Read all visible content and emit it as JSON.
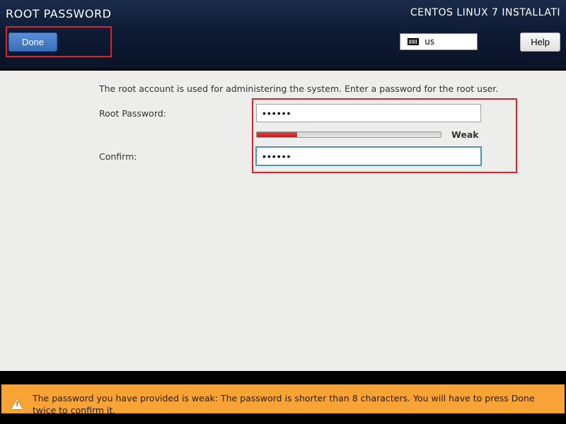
{
  "header": {
    "page_title": "ROOT PASSWORD",
    "installer_title": "CENTOS LINUX 7 INSTALLATI",
    "done_label": "Done",
    "keyboard_layout": "us",
    "help_label": "Help"
  },
  "main": {
    "description": "The root account is used for administering the system.  Enter a password for the root user.",
    "root_password_label": "Root Password:",
    "confirm_label": "Confirm:",
    "password_value": "••••••",
    "confirm_value": "••••••",
    "strength_label": "Weak"
  },
  "warning": {
    "text": "The password you have provided is weak: The password is shorter than 8 characters. You will have to press Done twice to confirm it."
  }
}
